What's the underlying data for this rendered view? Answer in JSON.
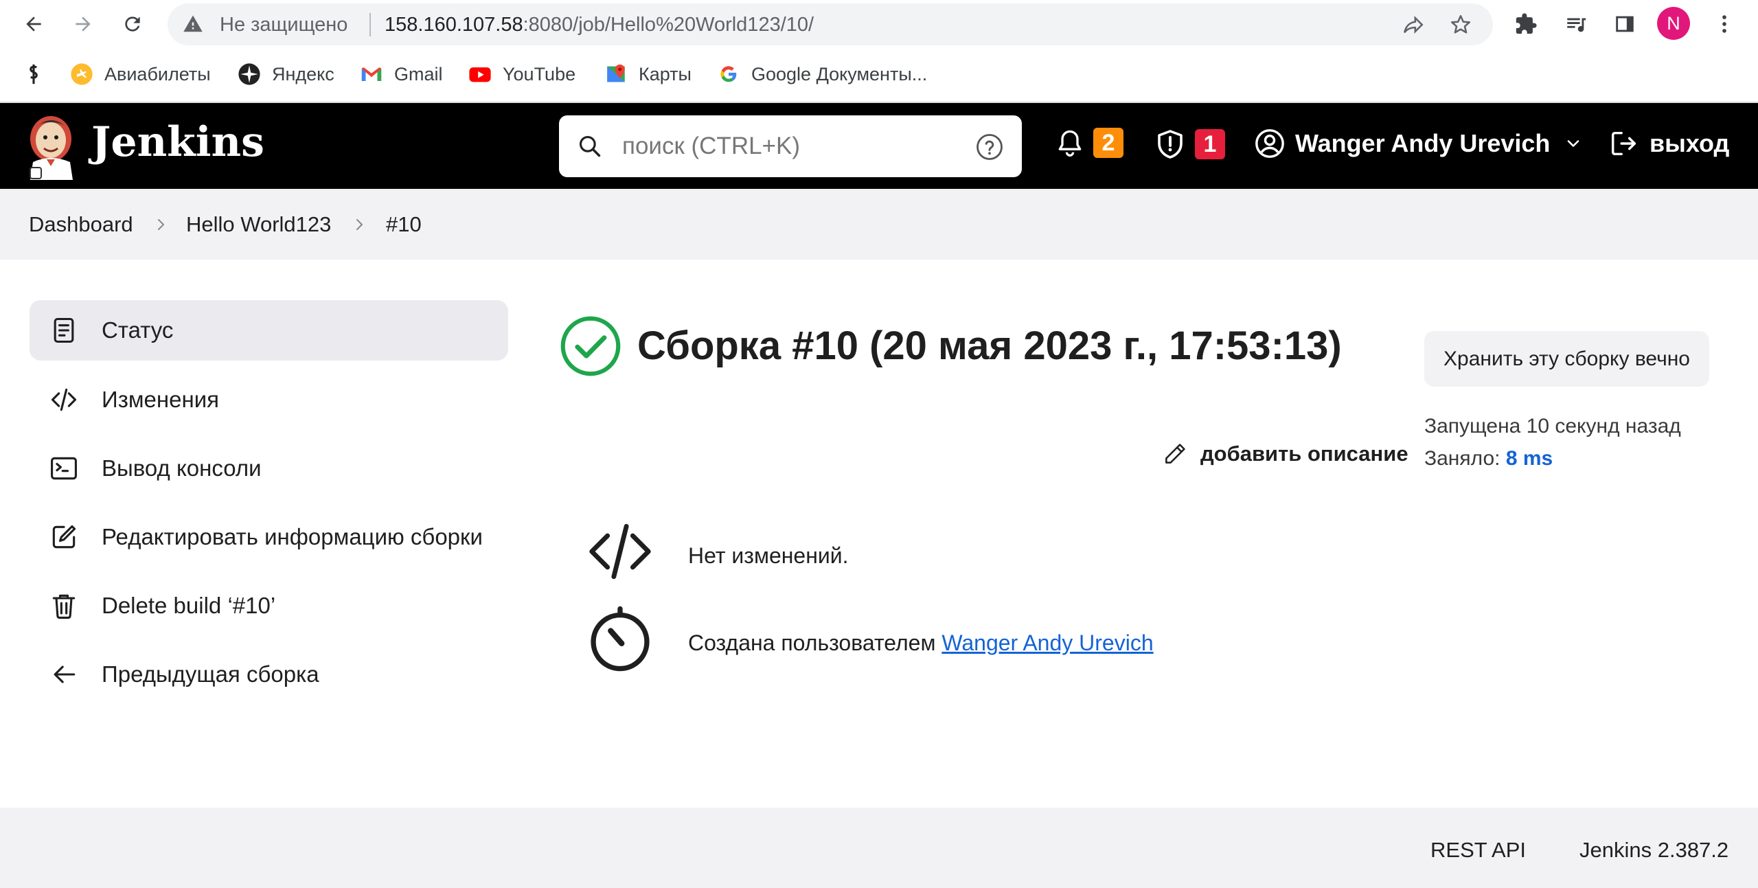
{
  "browser": {
    "security_label": "Не защищено",
    "url_host": "158.160.107.58",
    "url_rest": ":8080/job/Hello%20World123/10/",
    "profile_initial": "N",
    "bookmarks": [
      {
        "label": "Авиабилеты",
        "icon": "flight-icon"
      },
      {
        "label": "Яндекс",
        "icon": "yandex-icon"
      },
      {
        "label": "Gmail",
        "icon": "gmail-icon"
      },
      {
        "label": "YouTube",
        "icon": "youtube-icon"
      },
      {
        "label": "Карты",
        "icon": "maps-icon"
      },
      {
        "label": "Google Документы...",
        "icon": "google-icon"
      }
    ]
  },
  "header": {
    "brand": "Jenkins",
    "search_placeholder": "поиск (CTRL+K)",
    "notifications_count": "2",
    "security_count": "1",
    "user_name": "Wanger Andy Urevich",
    "logout_label": "выход"
  },
  "breadcrumbs": [
    "Dashboard",
    "Hello World123",
    "#10"
  ],
  "sidebar": {
    "items": [
      {
        "label": "Статус",
        "icon": "notepad-icon",
        "active": true
      },
      {
        "label": "Изменения",
        "icon": "code-icon"
      },
      {
        "label": "Вывод консоли",
        "icon": "terminal-icon"
      },
      {
        "label": "Редактировать информацию сборки",
        "icon": "edit-icon"
      },
      {
        "label": "Delete build ‘#10’",
        "icon": "trash-icon"
      },
      {
        "label": "Предыдущая сборка",
        "icon": "arrow-left-icon"
      }
    ]
  },
  "build": {
    "title": "Сборка #10 (20 мая 2023 г., 17:53:13)",
    "status": "success",
    "keep_forever_label": "Хранить эту сборку вечно",
    "started": "Запущена 10 секунд назад",
    "took_label": "Заняло: ",
    "took_value": "8 ms",
    "add_description": "добавить описание",
    "no_changes": "Нет изменений.",
    "created_by_prefix": "Создана пользователем ",
    "created_by_user": "Wanger Andy Urevich"
  },
  "footer": {
    "rest_api": "REST API",
    "version": "Jenkins 2.387.2"
  },
  "colors": {
    "header_bg": "#000000",
    "success": "#1ea64b",
    "badge_orange": "#fe8e0a",
    "badge_red": "#e6203c",
    "link": "#1463d6"
  }
}
